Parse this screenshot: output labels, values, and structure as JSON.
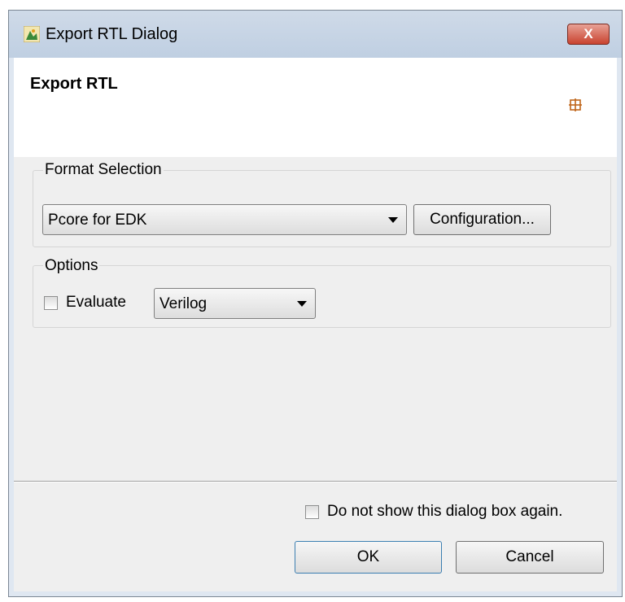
{
  "window": {
    "title": "Export RTL Dialog",
    "close_glyph": "X"
  },
  "header": {
    "title": "Export RTL",
    "icon": "grid-icon"
  },
  "format_selection": {
    "label": "Format Selection",
    "selected": "Pcore for EDK",
    "configuration_button": "Configuration..."
  },
  "options": {
    "label": "Options",
    "evaluate_label": "Evaluate",
    "evaluate_checked": false,
    "language_selected": "Verilog"
  },
  "footer": {
    "do_not_show_label": "Do not show this dialog box again.",
    "do_not_show_checked": false,
    "ok_label": "OK",
    "cancel_label": "Cancel"
  },
  "colors": {
    "accent_icon": "#c0651a",
    "close_button": "#c9432f"
  }
}
